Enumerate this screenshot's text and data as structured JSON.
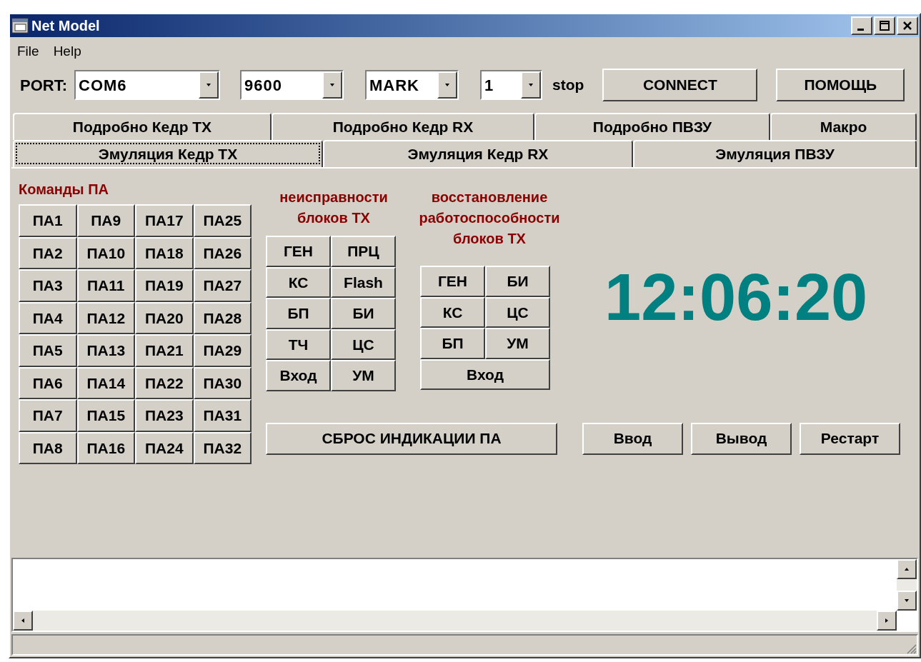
{
  "window": {
    "title": "Net Model"
  },
  "menu": [
    "File",
    "Help"
  ],
  "toolbar": {
    "port_label": "PORT:",
    "combos": [
      {
        "value": "COM6"
      },
      {
        "value": "9600"
      },
      {
        "value": "MARK"
      },
      {
        "value": "1"
      }
    ],
    "stop_label": "stop",
    "buttons": [
      "CONNECT",
      "ПОМОЩЬ"
    ]
  },
  "tab_rows": [
    [
      {
        "label": "Подробно Кедр TX",
        "selected": false
      },
      {
        "label": "Подробно Кедр RX",
        "selected": false
      },
      {
        "label": "Подробно ПВЗУ",
        "selected": false
      },
      {
        "label": "Макро",
        "selected": false
      }
    ],
    [
      {
        "label": "Эмуляция Кедр TX",
        "selected": true
      },
      {
        "label": "Эмуляция Кедр RX",
        "selected": false
      },
      {
        "label": "Эмуляция ПВЗУ",
        "selected": false
      }
    ]
  ],
  "commands": {
    "title": "Команды ПА",
    "buttons": [
      "ПА1",
      "ПА9",
      "ПА17",
      "ПА25",
      "ПА2",
      "ПА10",
      "ПА18",
      "ПА26",
      "ПА3",
      "ПА11",
      "ПА19",
      "ПА27",
      "ПА4",
      "ПА12",
      "ПА20",
      "ПА28",
      "ПА5",
      "ПА13",
      "ПА21",
      "ПА29",
      "ПА6",
      "ПА14",
      "ПА22",
      "ПА30",
      "ПА7",
      "ПА15",
      "ПА23",
      "ПА31",
      "ПА8",
      "ПА16",
      "ПА24",
      "ПА32"
    ]
  },
  "faults": {
    "title_lines": [
      "неисправности",
      "блоков TX"
    ],
    "buttons": [
      {
        "label": "ГЕН",
        "kind": "cell"
      },
      {
        "label": "ПРЦ",
        "kind": "cell"
      },
      {
        "label": "КС",
        "kind": "cell"
      },
      {
        "label": "Flash",
        "kind": "cell"
      },
      {
        "label": "БП",
        "kind": "cell"
      },
      {
        "label": "БИ",
        "kind": "cell"
      },
      {
        "label": "ТЧ",
        "kind": "cell"
      },
      {
        "label": "ЦС",
        "kind": "cell"
      },
      {
        "label": "Вход",
        "kind": "cell"
      },
      {
        "label": "УМ",
        "kind": "cell"
      }
    ]
  },
  "recovery": {
    "title_lines": [
      "восстановление",
      "работоспособности",
      "блоков TX"
    ],
    "buttons": [
      {
        "label": "ГЕН",
        "kind": "cell"
      },
      {
        "label": "БИ",
        "kind": "cell"
      },
      {
        "label": "КС",
        "kind": "cell"
      },
      {
        "label": "ЦС",
        "kind": "cell"
      },
      {
        "label": "БП",
        "kind": "cell"
      },
      {
        "label": "УМ",
        "kind": "cell"
      },
      {
        "label": "Вход",
        "kind": "wide"
      }
    ]
  },
  "clock": "12:06:20",
  "reset_button": "СБРОС ИНДИКАЦИИ ПА",
  "action_buttons": [
    "Ввод",
    "Вывод",
    "Рестарт"
  ]
}
